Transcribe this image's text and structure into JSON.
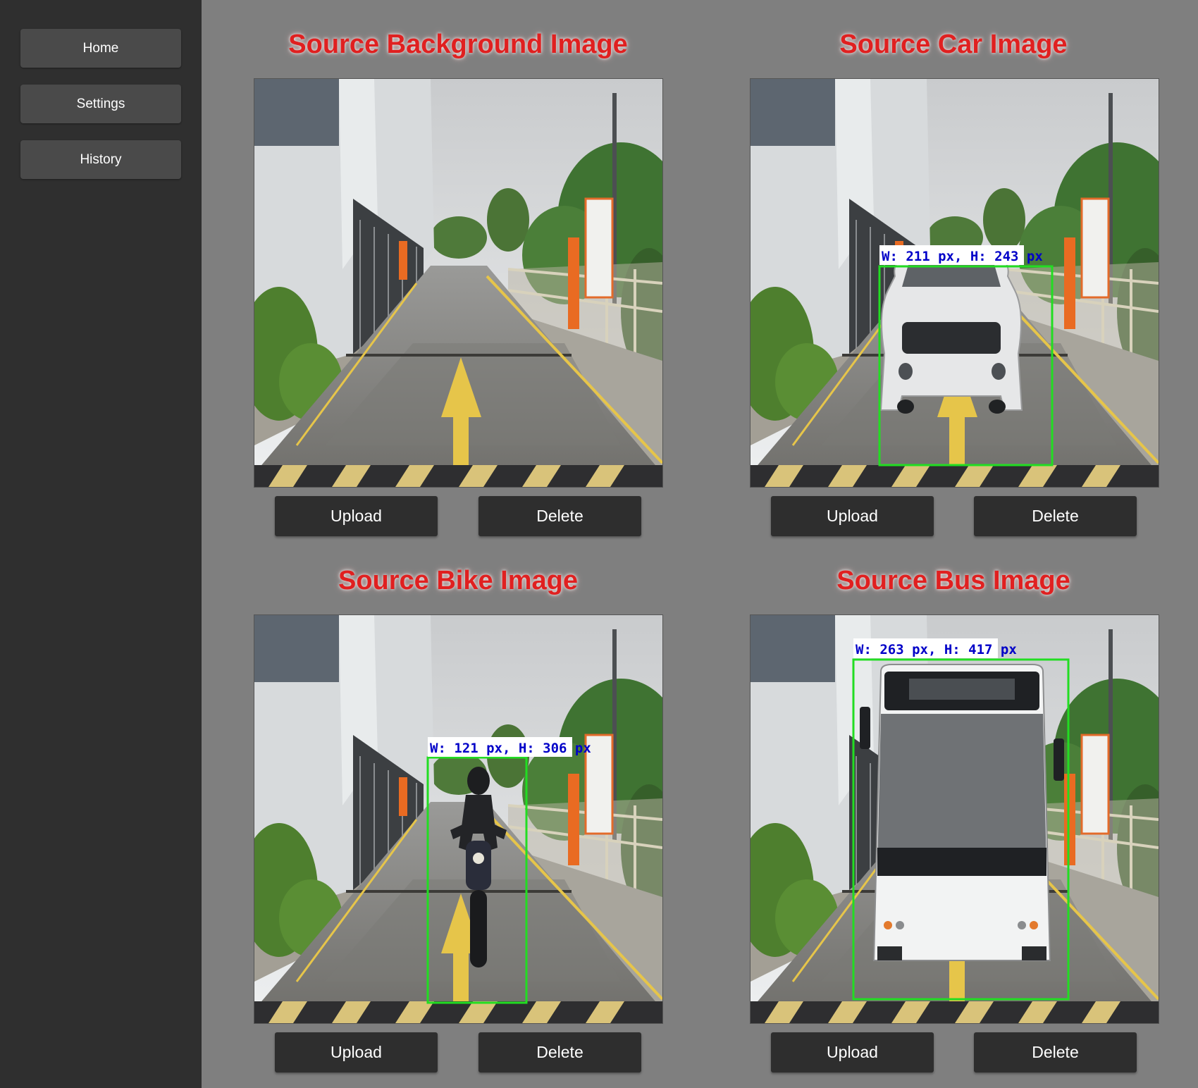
{
  "sidebar": {
    "items": [
      {
        "label": "Home"
      },
      {
        "label": "Settings"
      },
      {
        "label": "History"
      }
    ]
  },
  "panels": [
    {
      "title": "Source Background Image",
      "image": "parking ramp background scene",
      "detection": null,
      "upload_label": "Upload",
      "delete_label": "Delete"
    },
    {
      "title": "Source Car Image",
      "image": "white car on parking ramp",
      "detection": {
        "label": "W: 211 px, H: 243 px",
        "color": "#22dd22"
      },
      "upload_label": "Upload",
      "delete_label": "Delete"
    },
    {
      "title": "Source Bike Image",
      "image": "motorcyclist on parking ramp",
      "detection": {
        "label": "W: 121 px, H: 306 px",
        "color": "#22dd22"
      },
      "upload_label": "Upload",
      "delete_label": "Delete"
    },
    {
      "title": "Source Bus Image",
      "image": "white bus on parking ramp",
      "detection": {
        "label": "W: 263 px, H: 417 px",
        "color": "#22dd22"
      },
      "upload_label": "Upload",
      "delete_label": "Delete"
    }
  ],
  "colors": {
    "sidebar_bg": "#2f2f2f",
    "page_bg": "#7f7f7f",
    "title_red": "#e02020",
    "bbox_green": "#22dd22",
    "bbox_text_blue": "#0000c8"
  }
}
